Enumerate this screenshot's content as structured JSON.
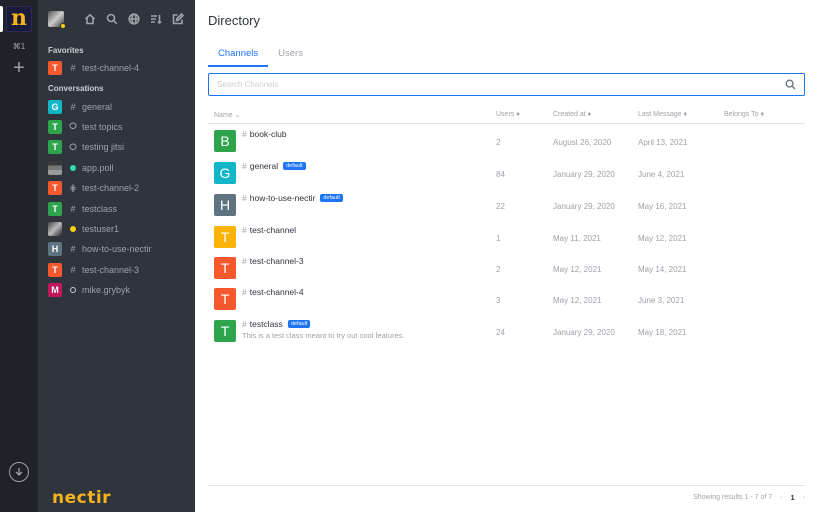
{
  "rail": {
    "brand_letter": "n",
    "shortcut": "⌘1",
    "add_symbol": "+"
  },
  "sidebar": {
    "favorites_label": "Favorites",
    "conversations_label": "Conversations",
    "favorites": [
      {
        "letter": "T",
        "color": "#f5582d",
        "kind": "#",
        "label": "test-channel-4"
      }
    ],
    "conversations": [
      {
        "letter": "G",
        "color": "#13b5c8",
        "kind": "#",
        "label": "general"
      },
      {
        "letter": "T",
        "color": "#2ea54d",
        "kind": "discussion",
        "label": "test topics"
      },
      {
        "letter": "T",
        "color": "#2ea54d",
        "kind": "discussion",
        "label": "testing jitsi"
      },
      {
        "letter": "",
        "color": "#888888",
        "kind": "status-online",
        "label": "app.poll"
      },
      {
        "letter": "T",
        "color": "#f5582d",
        "kind": "team",
        "label": "test-channel-2"
      },
      {
        "letter": "T",
        "color": "#2ea54d",
        "kind": "#",
        "label": "testclass"
      },
      {
        "letter": "",
        "color": "#666666",
        "kind": "status-away",
        "label": "testuser1"
      },
      {
        "letter": "H",
        "color": "#5e7481",
        "kind": "#",
        "label": "how-to-use-nectir"
      },
      {
        "letter": "T",
        "color": "#f5582d",
        "kind": "#",
        "label": "test-channel-3"
      },
      {
        "letter": "M",
        "color": "#c2185b",
        "kind": "status-offline",
        "label": "mike.grybyk"
      }
    ],
    "logo_text": "nectir"
  },
  "main": {
    "title": "Directory",
    "tabs": [
      {
        "label": "Channels",
        "active": true
      },
      {
        "label": "Users",
        "active": false
      }
    ],
    "search_placeholder": "Search Channels",
    "columns": {
      "name": "Name ⌄",
      "users": "Users ♦",
      "created": "Created at ♦",
      "last": "Last Message ♦",
      "belongs": "Belongs To ♦"
    },
    "rows": [
      {
        "letter": "B",
        "color": "#2ea54d",
        "name": "book-club",
        "badge": "",
        "topic": "",
        "users": "2",
        "created": "August 26, 2020",
        "last": "April 13, 2021"
      },
      {
        "letter": "G",
        "color": "#13b5c8",
        "name": "general",
        "badge": "default",
        "topic": "",
        "users": "84",
        "created": "January 29, 2020",
        "last": "June 4, 2021"
      },
      {
        "letter": "H",
        "color": "#5e7481",
        "name": "how-to-use-nectir",
        "badge": "default",
        "topic": "",
        "users": "22",
        "created": "January 29, 2020",
        "last": "May 16, 2021"
      },
      {
        "letter": "T",
        "color": "#fbb30a",
        "name": "test-channel",
        "badge": "",
        "topic": "",
        "users": "1",
        "created": "May 11, 2021",
        "last": "May 12, 2021"
      },
      {
        "letter": "T",
        "color": "#f5582d",
        "name": "test-channel-3",
        "badge": "",
        "topic": "",
        "users": "2",
        "created": "May 12, 2021",
        "last": "May 14, 2021"
      },
      {
        "letter": "T",
        "color": "#f5582d",
        "name": "test-channel-4",
        "badge": "",
        "topic": "",
        "users": "3",
        "created": "May 12, 2021",
        "last": "June 3, 2021"
      },
      {
        "letter": "T",
        "color": "#2ea54d",
        "name": "testclass",
        "badge": "default",
        "topic": "This is a test class meant to try out cool features.",
        "users": "24",
        "created": "January 29, 2020",
        "last": "May 18, 2021"
      }
    ],
    "pager": {
      "summary": "Showing results 1 - 7 of 7",
      "prev": "‹",
      "page": "1",
      "next": "›"
    }
  },
  "colors": {
    "accent": "#1d74f5",
    "brand": "#f6b31b",
    "sidebar_bg": "#2f343d",
    "rail_bg": "#1f2329"
  }
}
